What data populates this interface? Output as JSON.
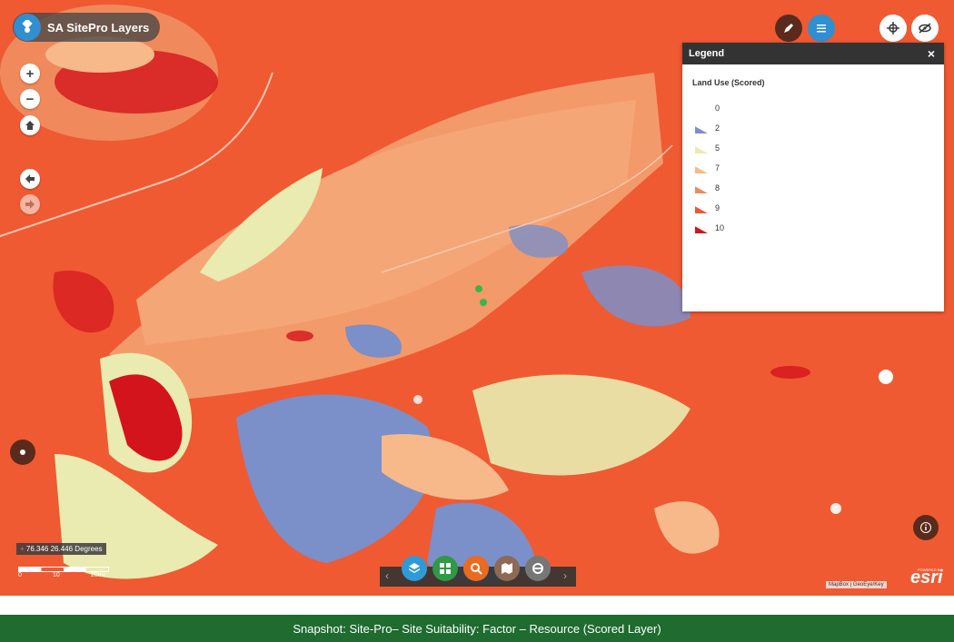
{
  "app": {
    "title": "SA SitePro Layers"
  },
  "legend": {
    "header": "Legend",
    "close_label": "×",
    "title": "Land Use (Scored)",
    "items": [
      {
        "label": "0",
        "color": "#ffffff"
      },
      {
        "label": "2",
        "color": "#7b8fc9"
      },
      {
        "label": "5",
        "color": "#e9ebb0"
      },
      {
        "label": "7",
        "color": "#f7b98a"
      },
      {
        "label": "8",
        "color": "#f08a5d"
      },
      {
        "label": "9",
        "color": "#e8593a"
      },
      {
        "label": "10",
        "color": "#d4141c"
      }
    ]
  },
  "map": {
    "coordinates": "76.346 26.446 Degrees",
    "scale": {
      "labels": [
        "0",
        "10",
        "20mi"
      ]
    },
    "attribution": "MapBox | GeoEye/Key",
    "powered_by": "POWERED BY",
    "brand": "esri"
  },
  "toolbar": {
    "prev": "‹",
    "next": "›",
    "items": [
      {
        "name": "layers-tool",
        "color": "#2f9ad8"
      },
      {
        "name": "basemap-gallery-tool",
        "color": "#2e9a45"
      },
      {
        "name": "search-tool",
        "color": "#ea6a1f"
      },
      {
        "name": "print-tool",
        "color": "#8c6a55"
      },
      {
        "name": "measure-tool",
        "color": "#777777"
      }
    ]
  },
  "footer": {
    "caption": "Snapshot: Site-Pro– Site Suitability: Factor – Resource (Scored Layer)"
  }
}
